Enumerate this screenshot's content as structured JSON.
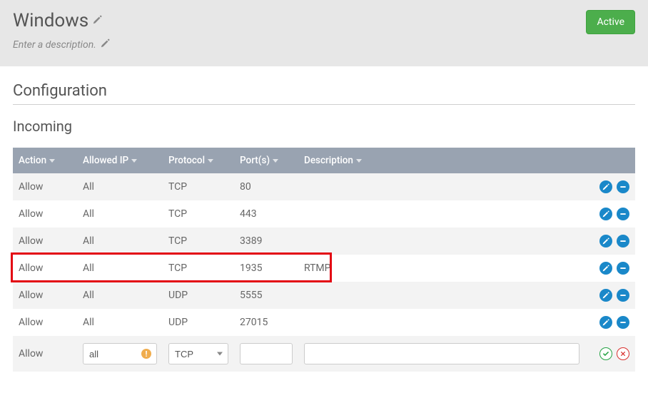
{
  "header": {
    "title": "Windows",
    "description_placeholder": "Enter a description.",
    "status_label": "Active"
  },
  "configuration": {
    "section_title": "Configuration",
    "incoming": {
      "title": "Incoming",
      "columns": {
        "action": "Action",
        "allowed_ip": "Allowed IP",
        "protocol": "Protocol",
        "ports": "Port(s)",
        "description": "Description"
      },
      "rows": [
        {
          "action": "Allow",
          "ip": "All",
          "protocol": "TCP",
          "ports": "80",
          "description": ""
        },
        {
          "action": "Allow",
          "ip": "All",
          "protocol": "TCP",
          "ports": "443",
          "description": ""
        },
        {
          "action": "Allow",
          "ip": "All",
          "protocol": "TCP",
          "ports": "3389",
          "description": ""
        },
        {
          "action": "Allow",
          "ip": "All",
          "protocol": "TCP",
          "ports": "1935",
          "description": "RTMP",
          "highlighted": true
        },
        {
          "action": "Allow",
          "ip": "All",
          "protocol": "UDP",
          "ports": "5555",
          "description": ""
        },
        {
          "action": "Allow",
          "ip": "All",
          "protocol": "UDP",
          "ports": "27015",
          "description": ""
        }
      ],
      "add_row": {
        "action": "Allow",
        "ip_value": "all",
        "ip_warning": "!",
        "protocol_value": "TCP",
        "ports_value": "",
        "description_value": ""
      }
    }
  }
}
